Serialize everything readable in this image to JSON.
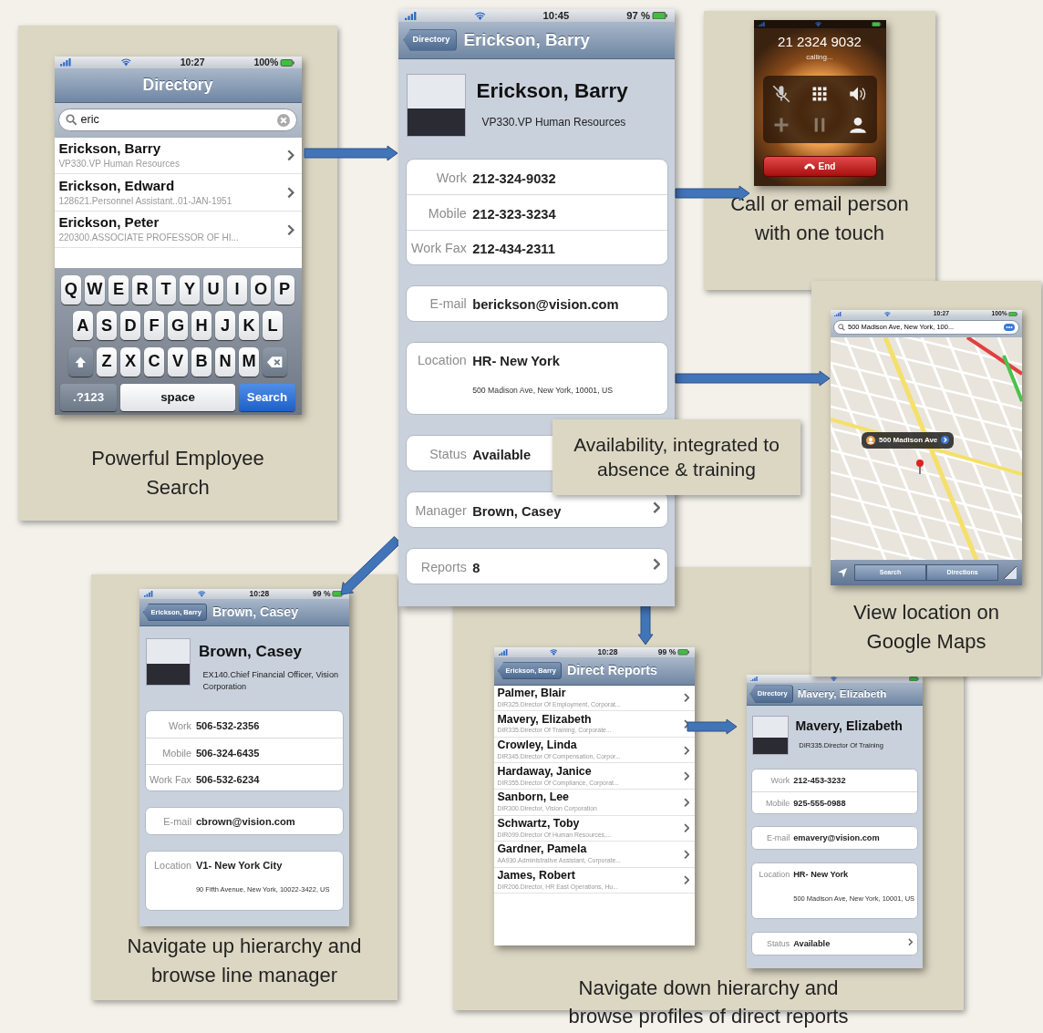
{
  "search_screen": {
    "status_bar": {
      "time": "10:27",
      "battery": "100%"
    },
    "title": "Directory",
    "search": {
      "value": "eric"
    },
    "results": [
      {
        "name": "Erickson, Barry",
        "detail": "VP330.VP Human Resources"
      },
      {
        "name": "Erickson, Edward",
        "detail": "128621.Personnel Assistant..01-JAN-1951"
      },
      {
        "name": "Erickson, Peter",
        "detail": "220300.ASSOCIATE PROFESSOR OF HI..."
      }
    ],
    "keyboard": {
      "rows": [
        [
          "Q",
          "W",
          "E",
          "R",
          "T",
          "Y",
          "U",
          "I",
          "O",
          "P"
        ],
        [
          "A",
          "S",
          "D",
          "F",
          "G",
          "H",
          "J",
          "K",
          "L"
        ],
        [
          "Z",
          "X",
          "C",
          "V",
          "B",
          "N",
          "M"
        ]
      ],
      "bottom_keys": [
        ".?123",
        "space",
        "Search"
      ]
    },
    "caption": "Powerful Employee Search"
  },
  "profile_screen": {
    "status_bar": {
      "time": "10:45",
      "battery": "97 %"
    },
    "back": "Directory",
    "title": "Erickson, Barry",
    "name": "Erickson, Barry",
    "position": "VP330.VP Human Resources",
    "groups": [
      [
        {
          "label": "Work",
          "value": "212-324-9032",
          "arrow": false
        },
        {
          "label": "Mobile",
          "value": "212-323-3234",
          "arrow": false
        },
        {
          "label": "Work Fax",
          "value": "212-434-2311",
          "arrow": false
        }
      ],
      [
        {
          "label": "E-mail",
          "value": "berickson@vision.com",
          "arrow": false
        }
      ],
      [
        {
          "label": "Location",
          "value": "HR- New York",
          "address": "500 Madison Ave, New York, 10001, US",
          "arrow": false
        }
      ],
      [
        {
          "label": "Status",
          "value": "Available",
          "arrow": false
        }
      ],
      [
        {
          "label": "Manager",
          "value": "Brown, Casey",
          "arrow": true
        }
      ],
      [
        {
          "label": "Reports",
          "value": "8",
          "arrow": true
        }
      ]
    ]
  },
  "availability_note": "Availability, integrated to absence & training",
  "call_screen": {
    "number": "21 2324 9032",
    "status": "calling...",
    "end_button": "End",
    "caption": "Call or email person with one touch"
  },
  "map_screen": {
    "status_bar": {
      "time": "10:27",
      "battery": "100%"
    },
    "search": {
      "value": "500 Madison Ave, New York, 100..."
    },
    "pin_label": "500 Madison Ave",
    "toolbar": [
      "Search",
      "Directions"
    ],
    "caption": "View location on Google Maps"
  },
  "manager_screen": {
    "status_bar": {
      "time": "10:28",
      "battery": "99 %"
    },
    "back": "Erickson, Barry",
    "title": "Brown, Casey",
    "name": "Brown, Casey",
    "position": "EX140.Chief Financial Officer, Vision Corporation",
    "groups": [
      [
        {
          "label": "Work",
          "value": "506-532-2356",
          "arrow": false
        },
        {
          "label": "Mobile",
          "value": "506-324-6435",
          "arrow": false
        },
        {
          "label": "Work Fax",
          "value": "506-532-6234",
          "arrow": false
        }
      ],
      [
        {
          "label": "E-mail",
          "value": "cbrown@vision.com",
          "arrow": false
        }
      ],
      [
        {
          "label": "Location",
          "value": "V1- New York City",
          "address": "90 Fifth Avenue, New York, 10022-3422, US",
          "arrow": false
        }
      ]
    ],
    "caption": "Navigate up hierarchy and browse line manager"
  },
  "reports_screen": {
    "status_bar": {
      "time": "10:28",
      "battery": "99 %"
    },
    "back": "Erickson, Barry",
    "title": "Direct Reports",
    "people": [
      {
        "name": "Palmer, Blair",
        "detail": "DIR325.Director Of Employment, Corporat..."
      },
      {
        "name": "Mavery, Elizabeth",
        "detail": "DIR335.Director Of Training, Corporate..."
      },
      {
        "name": "Crowley, Linda",
        "detail": "DIR345.Director Of Compensation, Corpor..."
      },
      {
        "name": "Hardaway, Janice",
        "detail": "DIR355.Director Of Compliance, Corporat..."
      },
      {
        "name": "Sanborn, Lee",
        "detail": "DIR300.Director, Vision Corporation"
      },
      {
        "name": "Schwartz, Toby",
        "detail": "DIR099.Director Of Human Resources,..."
      },
      {
        "name": "Gardner, Pamela",
        "detail": "AA930.Administrative Assistant, Corporate..."
      },
      {
        "name": "James, Robert",
        "detail": "DIR206.Director, HR East Operations, Hu..."
      }
    ]
  },
  "report_profile_screen": {
    "back": "Directory",
    "title": "Mavery, Elizabeth",
    "name": "Mavery, Elizabeth",
    "position": "DIR335.Director Of Training",
    "groups": [
      [
        {
          "label": "Work",
          "value": "212-453-3232",
          "arrow": false
        },
        {
          "label": "Mobile",
          "value": "925-555-0988",
          "arrow": false
        }
      ],
      [
        {
          "label": "E-mail",
          "value": "emavery@vision.com",
          "arrow": false
        }
      ],
      [
        {
          "label": "Location",
          "value": "HR- New York",
          "address": "500 Madison Ave, New York, 10001, US",
          "arrow": false
        }
      ],
      [
        {
          "label": "Status",
          "value": "Available",
          "arrow": true
        }
      ]
    ]
  },
  "bottom_caption": "Navigate down hierarchy and browse profiles of direct reports"
}
